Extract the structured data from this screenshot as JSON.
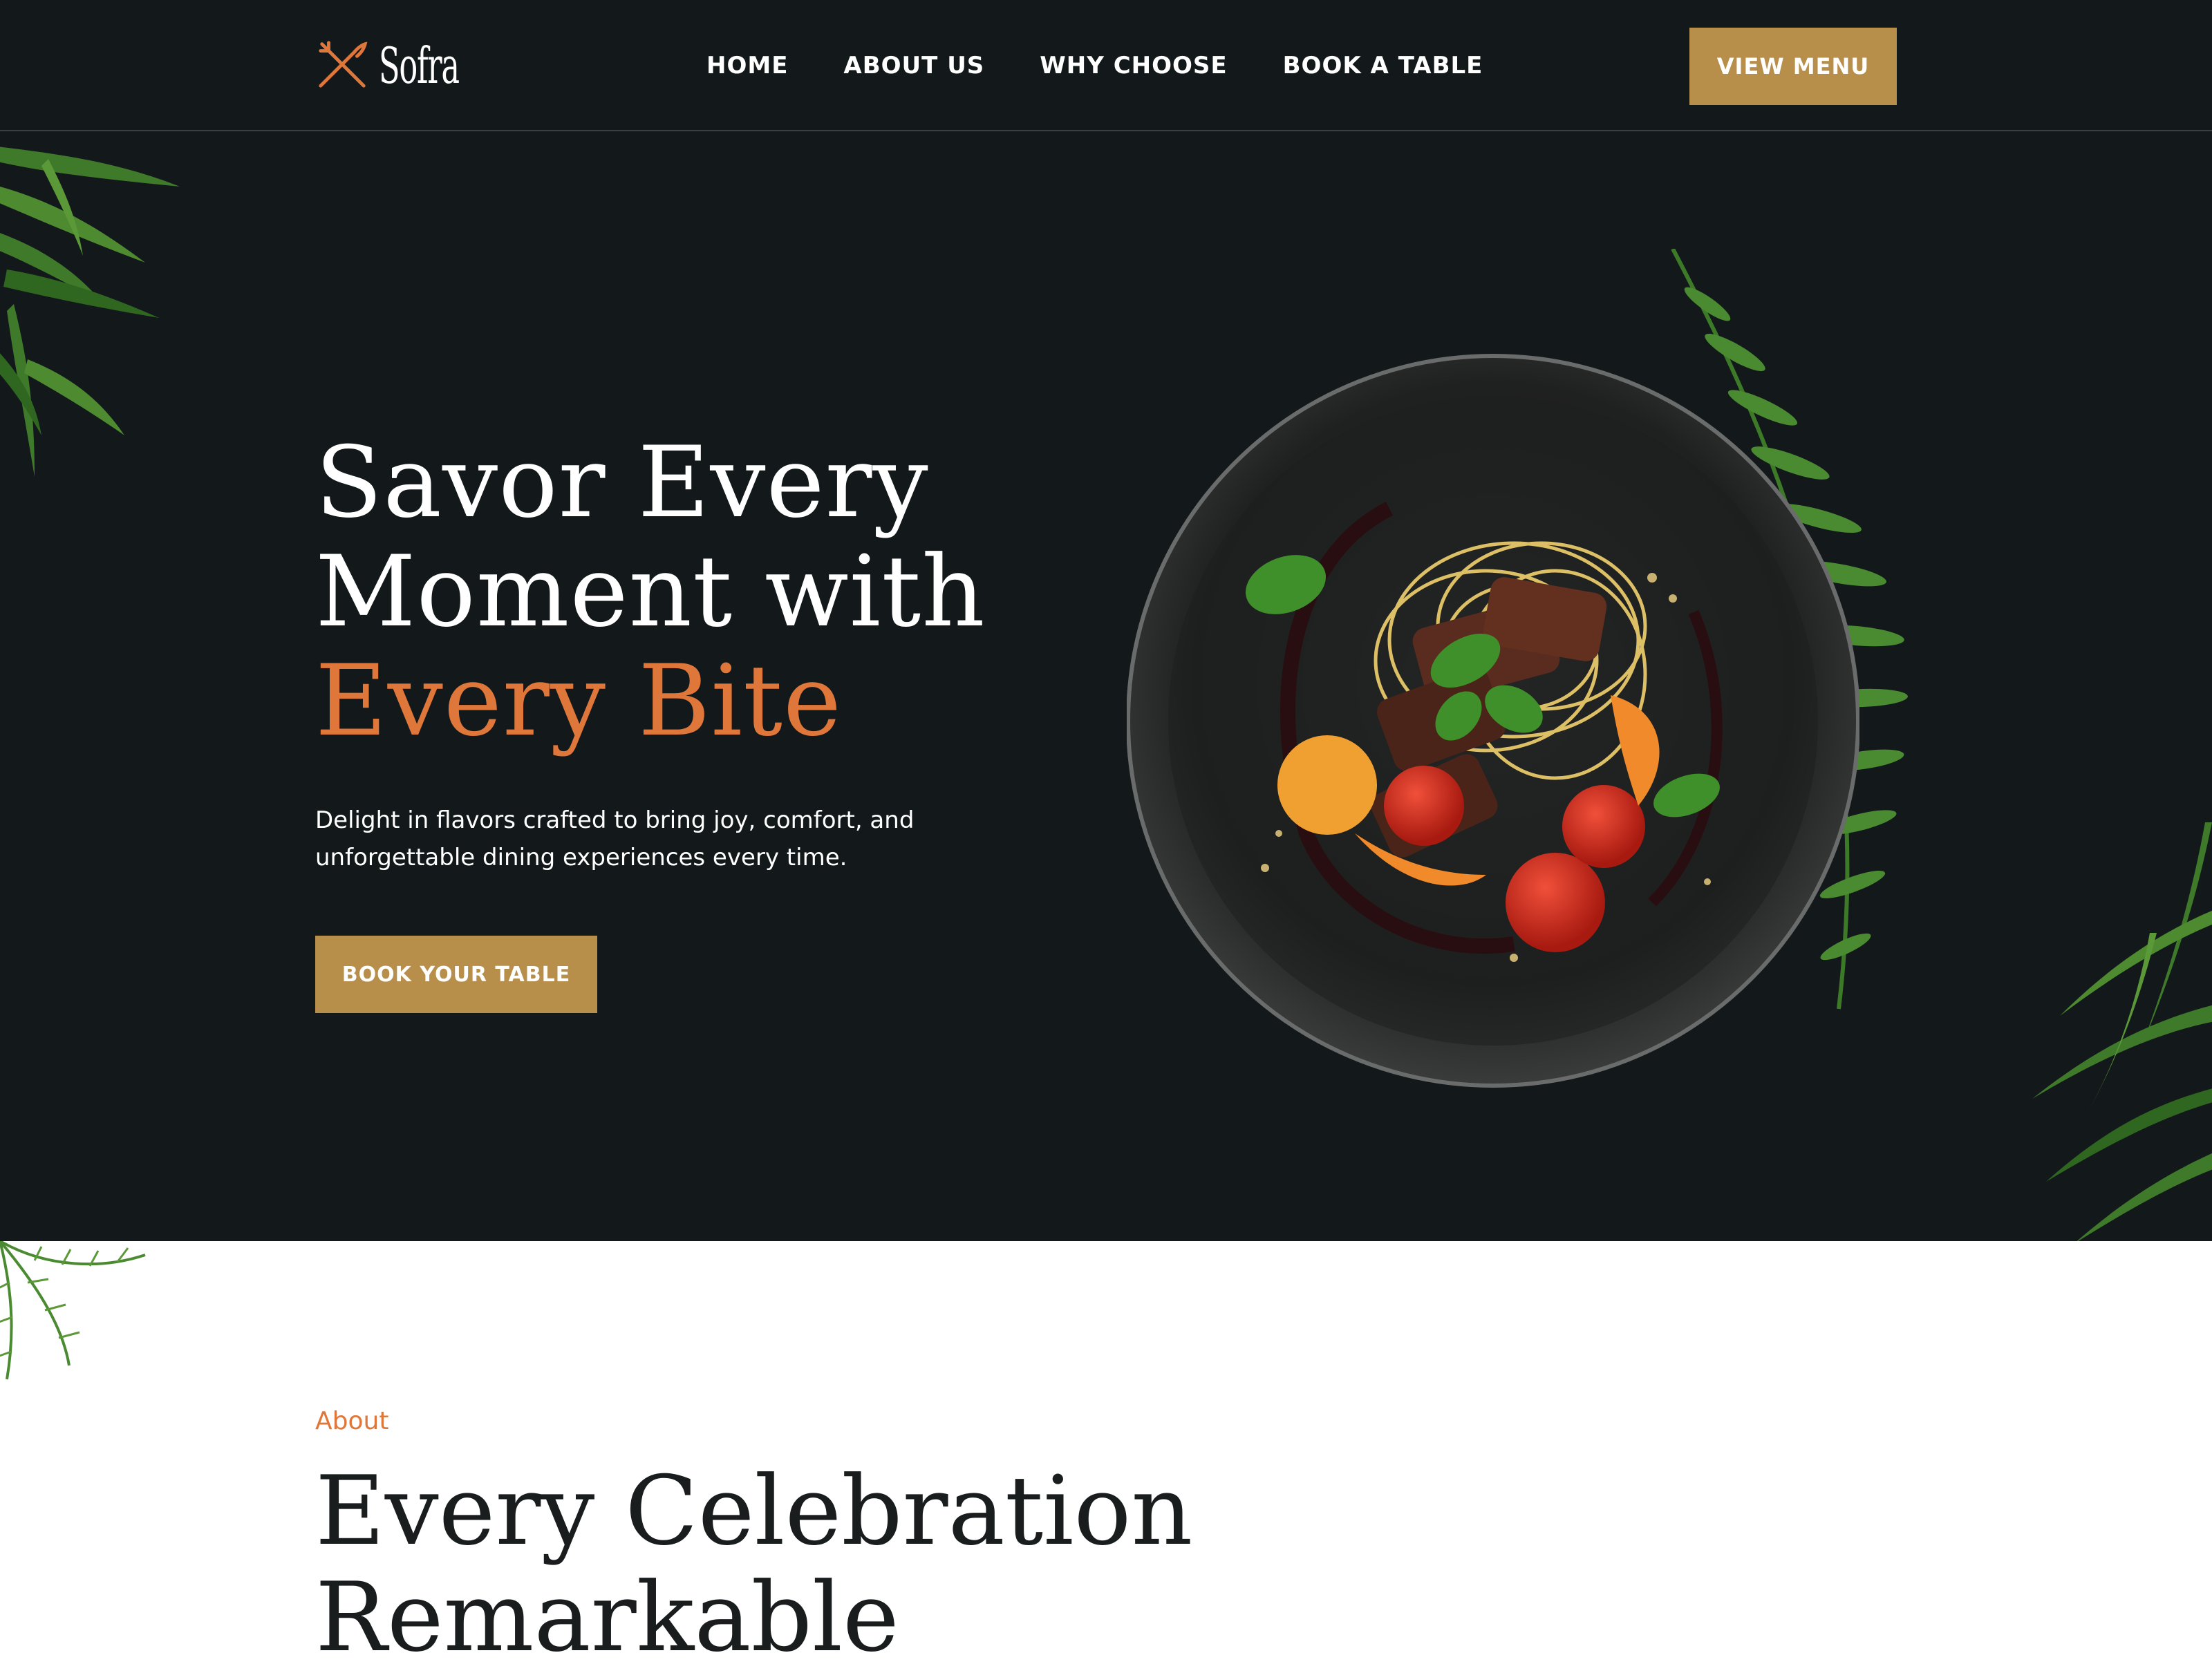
{
  "brand": {
    "name": "Sofra",
    "icon": "fork-knife-icon",
    "accent": "#e0773a"
  },
  "nav": {
    "items": [
      {
        "label": "HOME"
      },
      {
        "label": "ABOUT US"
      },
      {
        "label": "WHY CHOOSE"
      },
      {
        "label": "BOOK A TABLE"
      }
    ],
    "cta_label": "VIEW MENU"
  },
  "hero": {
    "title_line1": "Savor Every",
    "title_line2": "Moment with",
    "title_accent": "Every Bite",
    "subtitle": "Delight in flavors crafted to bring joy, comfort, and unforgettable dining experiences every time.",
    "cta_label": "BOOK YOUR TABLE"
  },
  "about": {
    "label": "About",
    "title_line1": "Every Celebration",
    "title_line2": "Remarkable"
  },
  "colors": {
    "background_dark": "#13191b",
    "gold": "#b78e4a",
    "orange": "#e0773a",
    "leaf_green": "#3f7a2a"
  }
}
